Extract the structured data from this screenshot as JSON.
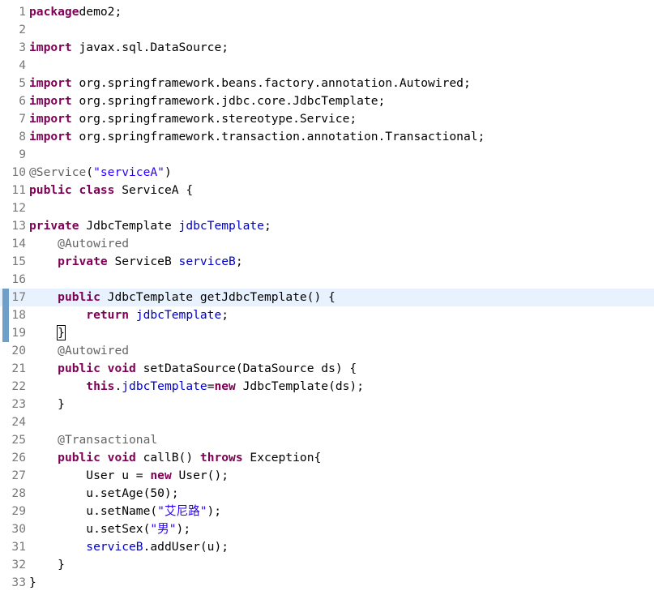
{
  "editor": {
    "colors": {
      "keyword": "#7f0055",
      "annotation": "#646464",
      "string": "#2a00ff",
      "field": "#0000c0",
      "line_number": "#787878",
      "current_line": "#e8f2fe",
      "change_marker": "#6f9fc8"
    },
    "lines": [
      {
        "n": "1",
        "t": [
          [
            "kw",
            "package"
          ],
          [
            "",
            "demo2;"
          ]
        ]
      },
      {
        "n": "2",
        "t": []
      },
      {
        "n": "3",
        "t": [
          [
            "kw",
            "import"
          ],
          [
            "",
            " javax.sql.DataSource;"
          ]
        ]
      },
      {
        "n": "4",
        "t": []
      },
      {
        "n": "5",
        "t": [
          [
            "kw",
            "import"
          ],
          [
            "",
            " org.springframework.beans.factory.annotation.Autowired;"
          ]
        ]
      },
      {
        "n": "6",
        "t": [
          [
            "kw",
            "import"
          ],
          [
            "",
            " org.springframework.jdbc.core.JdbcTemplate;"
          ]
        ]
      },
      {
        "n": "7",
        "t": [
          [
            "kw",
            "import"
          ],
          [
            "",
            " org.springframework.stereotype.Service;"
          ]
        ]
      },
      {
        "n": "8",
        "t": [
          [
            "kw",
            "import"
          ],
          [
            "",
            " org.springframework.transaction.annotation.Transactional;"
          ]
        ]
      },
      {
        "n": "9",
        "t": []
      },
      {
        "n": "10",
        "t": [
          [
            "ann",
            "@Service"
          ],
          [
            "",
            "("
          ],
          [
            "str",
            "\"serviceA\""
          ],
          [
            "",
            ")"
          ]
        ]
      },
      {
        "n": "11",
        "t": [
          [
            "kw",
            "public"
          ],
          [
            "",
            " "
          ],
          [
            "kw",
            "class"
          ],
          [
            "",
            " ServiceA {"
          ]
        ]
      },
      {
        "n": "12",
        "t": []
      },
      {
        "n": "13",
        "t": [
          [
            "kw",
            "private"
          ],
          [
            "",
            " JdbcTemplate "
          ],
          [
            "fld",
            "jdbcTemplate"
          ],
          [
            "",
            ";"
          ]
        ]
      },
      {
        "n": "14",
        "t": [
          [
            "",
            "    "
          ],
          [
            "ann",
            "@Autowired"
          ]
        ]
      },
      {
        "n": "15",
        "t": [
          [
            "",
            "    "
          ],
          [
            "kw",
            "private"
          ],
          [
            "",
            " ServiceB "
          ],
          [
            "fld",
            "serviceB"
          ],
          [
            "",
            ";"
          ]
        ]
      },
      {
        "n": "16",
        "t": []
      },
      {
        "n": "17",
        "t": [
          [
            "",
            "    "
          ],
          [
            "kw",
            "public"
          ],
          [
            "",
            " JdbcTemplate getJdbcTemplate() {"
          ]
        ]
      },
      {
        "n": "18",
        "t": [
          [
            "",
            "        "
          ],
          [
            "kw",
            "return"
          ],
          [
            "",
            " "
          ],
          [
            "fld",
            "jdbcTemplate"
          ],
          [
            "",
            ";"
          ]
        ]
      },
      {
        "n": "19",
        "t": [
          [
            "",
            "    "
          ],
          [
            "cursor",
            "}"
          ]
        ]
      },
      {
        "n": "20",
        "t": [
          [
            "",
            "    "
          ],
          [
            "ann",
            "@Autowired"
          ]
        ]
      },
      {
        "n": "21",
        "t": [
          [
            "",
            "    "
          ],
          [
            "kw",
            "public"
          ],
          [
            "",
            " "
          ],
          [
            "kw",
            "void"
          ],
          [
            "",
            " setDataSource(DataSource "
          ],
          [
            "",
            "ds) {"
          ]
        ]
      },
      {
        "n": "22",
        "t": [
          [
            "",
            "        "
          ],
          [
            "kw",
            "this"
          ],
          [
            "",
            "."
          ],
          [
            "fld",
            "jdbcTemplate"
          ],
          [
            "",
            "="
          ],
          [
            "kw",
            "new"
          ],
          [
            "",
            " JdbcTemplate(ds);"
          ]
        ]
      },
      {
        "n": "23",
        "t": [
          [
            "",
            "    }"
          ]
        ]
      },
      {
        "n": "24",
        "t": []
      },
      {
        "n": "25",
        "t": [
          [
            "",
            "    "
          ],
          [
            "ann",
            "@Transactional"
          ]
        ]
      },
      {
        "n": "26",
        "t": [
          [
            "",
            "    "
          ],
          [
            "kw",
            "public"
          ],
          [
            "",
            " "
          ],
          [
            "kw",
            "void"
          ],
          [
            "",
            " callB() "
          ],
          [
            "kw",
            "throws"
          ],
          [
            "",
            " Exception{"
          ]
        ]
      },
      {
        "n": "27",
        "t": [
          [
            "",
            "        User u = "
          ],
          [
            "kw",
            "new"
          ],
          [
            "",
            " User();"
          ]
        ]
      },
      {
        "n": "28",
        "t": [
          [
            "",
            "        u.setAge(50);"
          ]
        ]
      },
      {
        "n": "29",
        "t": [
          [
            "",
            "        u.setName("
          ],
          [
            "str",
            "\"艾尼路\""
          ],
          [
            "",
            ");"
          ]
        ]
      },
      {
        "n": "30",
        "t": [
          [
            "",
            "        u.setSex("
          ],
          [
            "str",
            "\"男\""
          ],
          [
            "",
            ");"
          ]
        ]
      },
      {
        "n": "31",
        "t": [
          [
            "",
            "        "
          ],
          [
            "fld",
            "serviceB"
          ],
          [
            "",
            ".addUser(u);"
          ]
        ]
      },
      {
        "n": "32",
        "t": [
          [
            "",
            "    }"
          ]
        ]
      },
      {
        "n": "33",
        "t": [
          [
            "",
            "}"
          ]
        ]
      }
    ],
    "current_line": "17",
    "changed_lines": [
      "17",
      "18",
      "19"
    ]
  }
}
